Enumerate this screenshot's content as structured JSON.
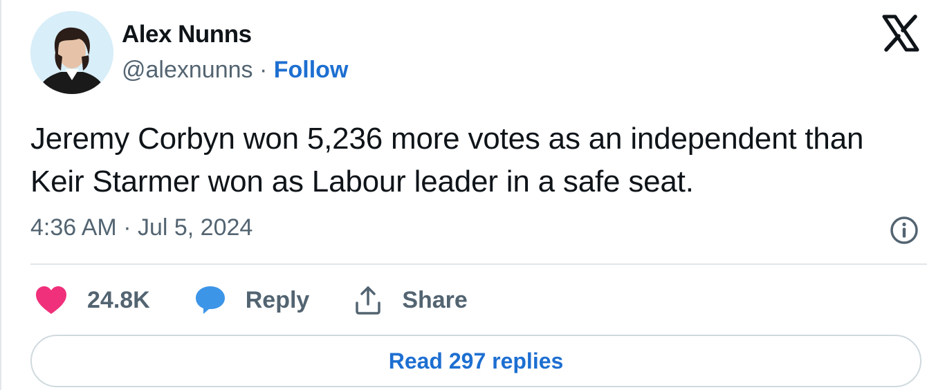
{
  "author": {
    "name": "Alex Nunns",
    "handle": "@alexnunns",
    "separator": " · ",
    "follow_label": "Follow",
    "avatar_icon": "profile-photo"
  },
  "brand": {
    "logo_icon": "x-logo-icon"
  },
  "tweet": {
    "text": "Jeremy Corbyn won 5,236 more votes as an independent than Keir Starmer won as Labour leader in a safe seat.",
    "timestamp": "4:36 AM · Jul 5, 2024"
  },
  "actions": {
    "like_count": "24.8K",
    "reply_label": "Reply",
    "share_label": "Share"
  },
  "replies": {
    "read_label": "Read 297 replies"
  },
  "colors": {
    "like": "#f0307a",
    "reply": "#3d95e8",
    "link": "#1d6fd1",
    "muted": "#536471"
  }
}
